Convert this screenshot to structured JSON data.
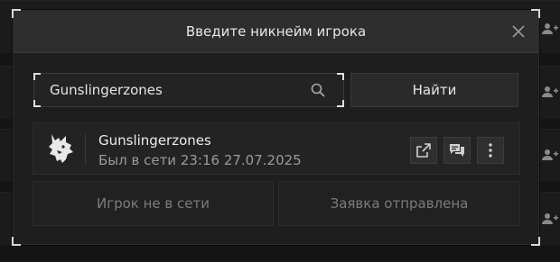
{
  "modal": {
    "title": "Введите никнейм игрока"
  },
  "search": {
    "value": "Gunslingerzones",
    "find_label": "Найти"
  },
  "player": {
    "name": "Gunslingerzones",
    "last_seen": "Был в сети 23:16 27.07.2025"
  },
  "actions": {
    "status_label": "Игрок не в сети",
    "request_label": "Заявка отправлена"
  },
  "icons": {
    "close": "close-icon",
    "search": "search-icon",
    "open": "external-link-icon",
    "message": "chat-icon",
    "more": "more-vertical-icon",
    "avatar": "wolf-logo-icon",
    "add_friend": "add-user-icon"
  },
  "colors": {
    "modal_bg": "#1e1e1e",
    "header_bg": "#2e2e2e",
    "text": "#e6e6e6",
    "muted": "#9a9a9a"
  }
}
